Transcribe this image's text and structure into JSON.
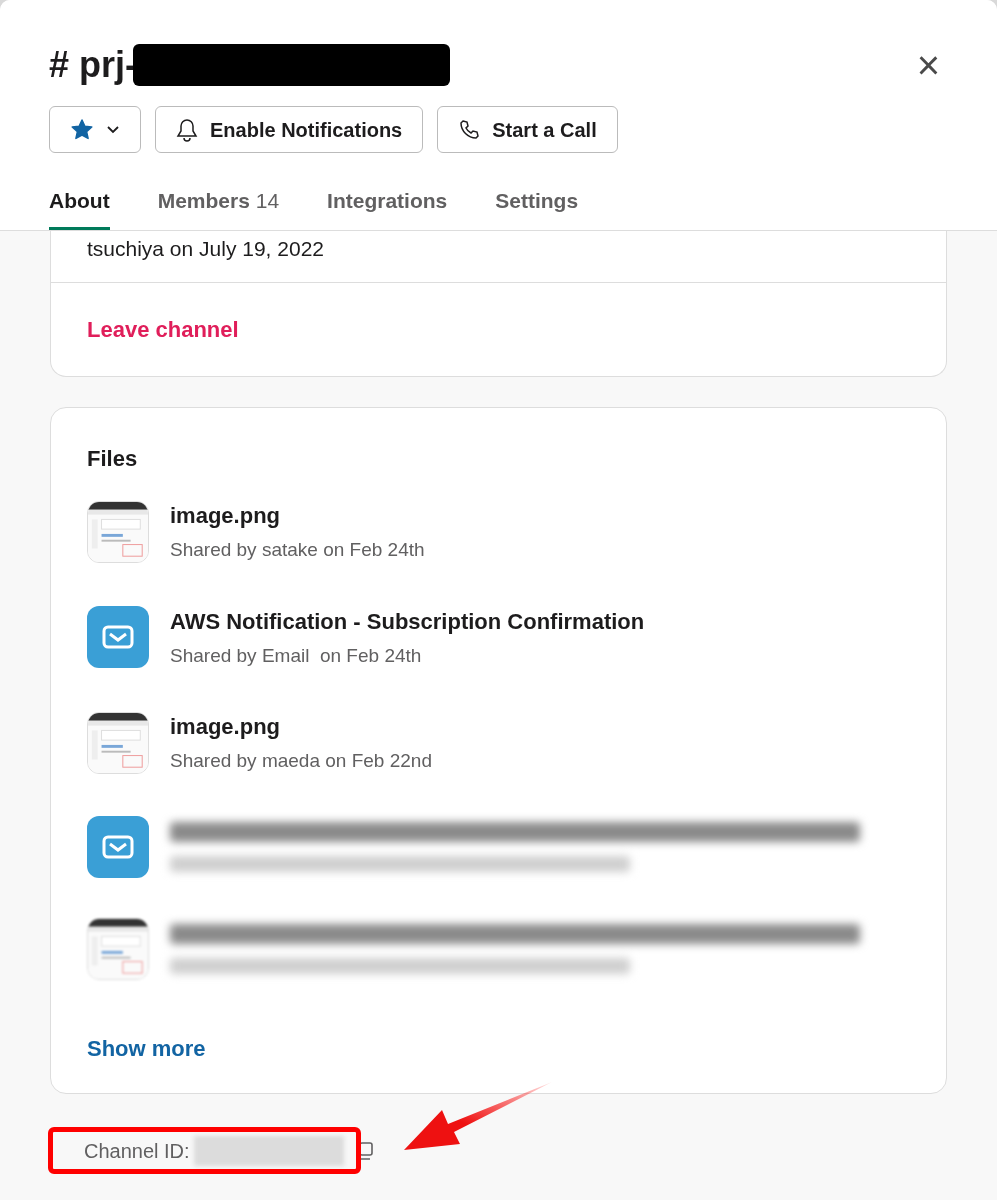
{
  "header": {
    "title_prefix": "# prj-",
    "close": "×"
  },
  "actions": [
    {
      "kind": "star",
      "starred": true
    },
    {
      "kind": "bell",
      "label": "Enable Notifications"
    },
    {
      "kind": "phone",
      "label": "Start a Call"
    }
  ],
  "tabs": [
    {
      "label": "About",
      "selected": true
    },
    {
      "label": "Members",
      "count": "14",
      "selected": false
    },
    {
      "label": "Integrations",
      "selected": false
    },
    {
      "label": "Settings",
      "selected": false
    }
  ],
  "about": {
    "created_line": "tsuchiya on July 19, 2022",
    "leave": "Leave channel"
  },
  "files": {
    "heading": "Files",
    "items": [
      {
        "name": "image.png",
        "meta": "Shared by satake on Feb 24th"
      },
      {
        "kind": "email",
        "name": "AWS Notification - Subscription Confirmation",
        "meta": "Shared by Email  on Feb 24th"
      },
      {
        "name": "image.png",
        "meta": "Shared by maeda on Feb 22nd"
      },
      {
        "kind": "blurred_email"
      },
      {
        "kind": "blurred_image"
      }
    ],
    "show_more": "Show more"
  },
  "channel_id": {
    "label": "Channel ID:"
  }
}
